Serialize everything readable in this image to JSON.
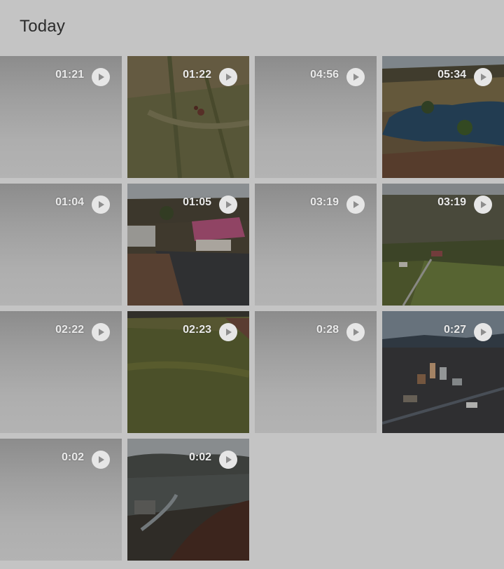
{
  "section": {
    "title": "Today"
  },
  "videos": [
    {
      "duration": "01:21",
      "thumb": "placeholder"
    },
    {
      "duration": "01:22",
      "thumb": "grass-field-aerial"
    },
    {
      "duration": "04:56",
      "thumb": "placeholder"
    },
    {
      "duration": "05:34",
      "thumb": "lake-aerial"
    },
    {
      "duration": "01:04",
      "thumb": "placeholder"
    },
    {
      "duration": "01:05",
      "thumb": "house-yard-aerial"
    },
    {
      "duration": "03:19",
      "thumb": "placeholder"
    },
    {
      "duration": "03:19",
      "thumb": "farmland-aerial"
    },
    {
      "duration": "02:22",
      "thumb": "placeholder"
    },
    {
      "duration": "02:23",
      "thumb": "grass-hill"
    },
    {
      "duration": "0:28",
      "thumb": "placeholder"
    },
    {
      "duration": "0:27",
      "thumb": "city-aerial"
    },
    {
      "duration": "0:02",
      "thumb": "placeholder"
    },
    {
      "duration": "0:02",
      "thumb": "valley-town-aerial"
    }
  ]
}
